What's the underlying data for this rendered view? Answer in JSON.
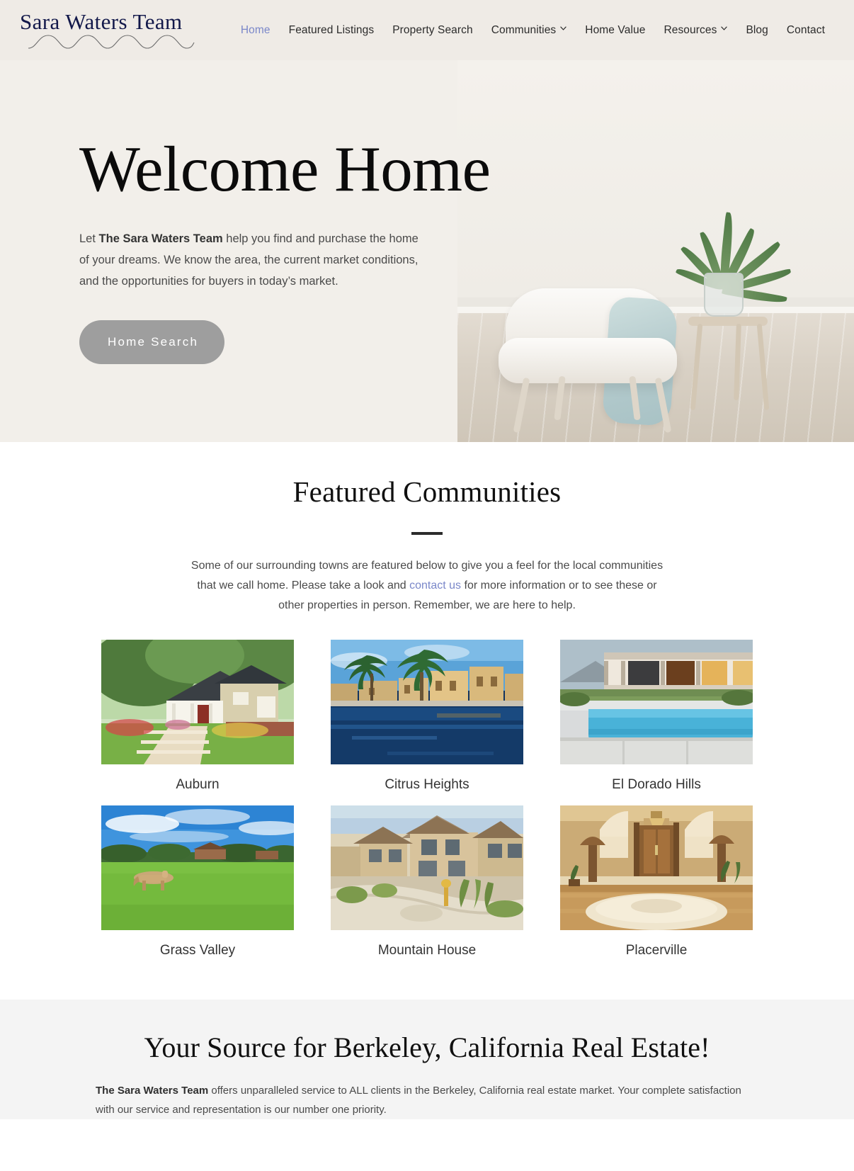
{
  "brand": {
    "logo_text": "Sara Waters Team",
    "logo_color": "#12184a",
    "wave_icon": "wave-flourish-icon"
  },
  "nav": {
    "active_color": "#7a87c9",
    "items": [
      {
        "label": "Home",
        "active": true,
        "has_dropdown": false
      },
      {
        "label": "Featured Listings",
        "active": false,
        "has_dropdown": false
      },
      {
        "label": "Property Search",
        "active": false,
        "has_dropdown": false
      },
      {
        "label": "Communities",
        "active": false,
        "has_dropdown": true
      },
      {
        "label": "Home Value",
        "active": false,
        "has_dropdown": false
      },
      {
        "label": "Resources",
        "active": false,
        "has_dropdown": true
      },
      {
        "label": "Blog",
        "active": false,
        "has_dropdown": false
      },
      {
        "label": "Contact",
        "active": false,
        "has_dropdown": false
      }
    ]
  },
  "hero": {
    "title": "Welcome Home",
    "paragraph_pre": "Let ",
    "paragraph_bold": "The Sara Waters Team",
    "paragraph_post": " help you find and purchase the home of your dreams. We know the area, the current market conditions, and the opportunities for buyers in today’s market.",
    "button_label": "Home Search",
    "button_color": "#9e9e9e",
    "background_color": "#f2efea",
    "image_alt": "white-armchair-with-plant-photo"
  },
  "featured": {
    "title": "Featured Communities",
    "divider": "short-rule",
    "intro_pre": "Some of our surrounding towns are featured below to give you a feel for the local communities that we call home. Please take a look and ",
    "intro_link": "contact us",
    "intro_post": " for more information or to see these or other properties in person. Remember, we are here to help.",
    "link_color": "#7a87c9",
    "communities": [
      {
        "name": "Auburn",
        "image": "craftsman-home-with-trees-photo"
      },
      {
        "name": "Citrus Heights",
        "image": "waterfront-villas-with-palms-photo"
      },
      {
        "name": "El Dorado Hills",
        "image": "modern-house-with-pool-photo"
      },
      {
        "name": "Grass Valley",
        "image": "horse-in-pasture-photo"
      },
      {
        "name": "Mountain House",
        "image": "suburban-street-homes-photo"
      },
      {
        "name": "Placerville",
        "image": "luxury-foyer-interior-photo"
      }
    ]
  },
  "band": {
    "title": "Your Source for Berkeley, California Real Estate!",
    "paragraph_bold": "The Sara Waters Team",
    "paragraph_post": " offers unparalleled service to ALL clients in the Berkeley, California real estate market. Your complete satisfaction with our service and representation is our number one priority.",
    "background_color": "#f4f4f4"
  }
}
